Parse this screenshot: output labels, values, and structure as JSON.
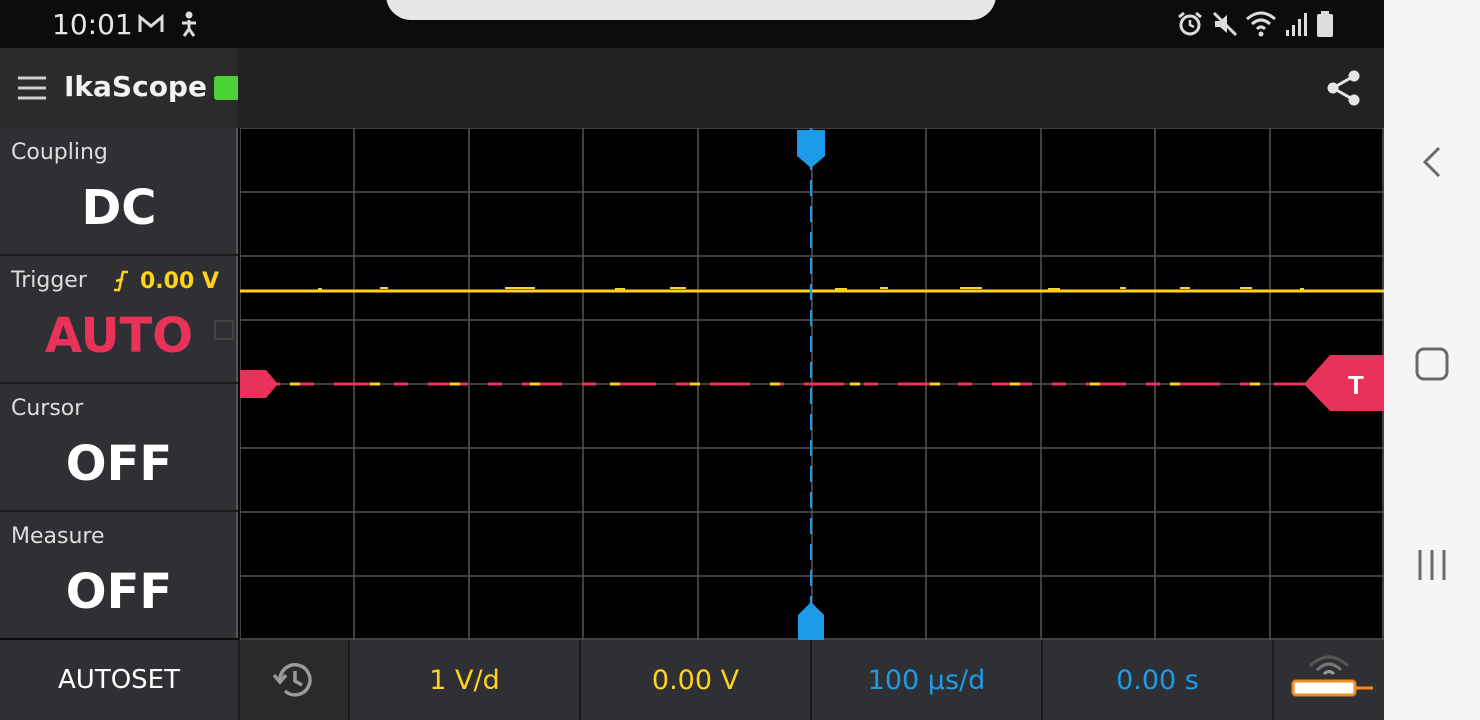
{
  "status_bar": {
    "time": "10:01",
    "left_icons": [
      "gmail-icon",
      "accessibility-icon"
    ],
    "right_icons": [
      "alarm-icon",
      "mute-icon",
      "wifi-icon",
      "signal-icon",
      "battery-icon"
    ]
  },
  "header": {
    "title": "IkaScope",
    "menu_icon": "hamburger-menu-icon",
    "share_icon": "share-icon",
    "battery_color": "#4cd137"
  },
  "panels": {
    "coupling": {
      "label": "Coupling",
      "value": "DC"
    },
    "trigger": {
      "label": "Trigger",
      "level": "0.00 V",
      "value": "AUTO",
      "value_color": "#e8325a",
      "level_color": "#ffd21f"
    },
    "cursor": {
      "label": "Cursor",
      "value": "OFF"
    },
    "measure": {
      "label": "Measure",
      "value": "OFF"
    }
  },
  "scope": {
    "trigger_marker": "T",
    "trace_color": "#ffd21f",
    "trigger_color": "#e8325a",
    "cursor_color": "#1e9be8"
  },
  "bottom_bar": {
    "autoset": "AUTOSET",
    "history_icon": "history-icon",
    "volts_per_div": "1 V/d",
    "v_offset": "0.00 V",
    "time_per_div": "100 µs/d",
    "t_offset": "0.00 s",
    "probe_icon": "probe-wireless-icon",
    "yellow": "#ffd21f",
    "blue": "#1e9be8"
  }
}
